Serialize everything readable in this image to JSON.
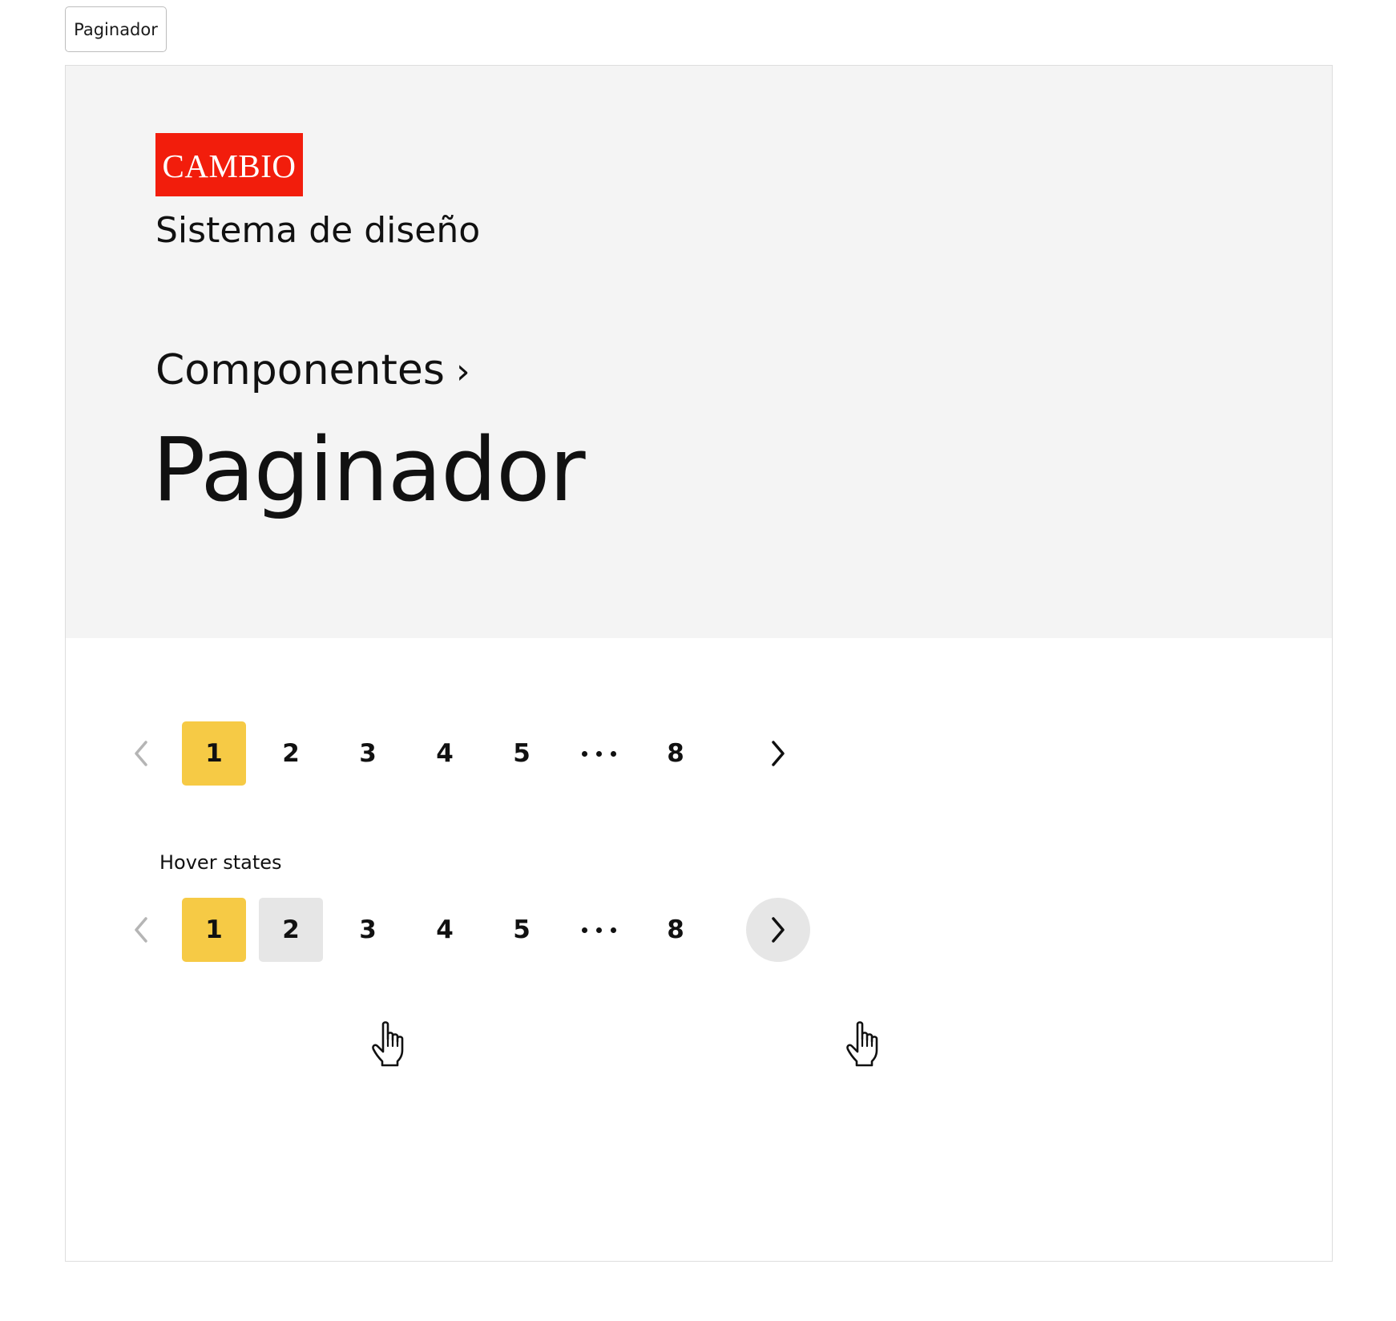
{
  "tag": {
    "label": "Paginador"
  },
  "header": {
    "logo_text": "CAMBIO",
    "subtitle": "Sistema de diseño",
    "breadcrumb": {
      "link": "Componentes",
      "separator": "›"
    },
    "title": "Paginador"
  },
  "colors": {
    "logo_red": "#f21d0c",
    "header_bg": "#f4f4f4",
    "active_page": "#f6ca45",
    "hover_bg": "#e6e6e6",
    "disabled_arrow": "#b5b5b5"
  },
  "paginator_default": {
    "prev_icon": "chevron-left-icon",
    "pages": [
      "1",
      "2",
      "3",
      "4",
      "5"
    ],
    "ellipsis": "•••",
    "last_page": "8",
    "next_icon": "chevron-right-icon",
    "active_page": "1"
  },
  "hover_section": {
    "label": "Hover states"
  },
  "paginator_hover": {
    "prev_icon": "chevron-left-icon",
    "pages": [
      "1",
      "2",
      "3",
      "4",
      "5"
    ],
    "ellipsis": "•••",
    "last_page": "8",
    "next_icon": "chevron-right-icon",
    "active_page": "1",
    "hovered_page": "2",
    "hovered_next": true,
    "cursor_icon": "hand-pointer-icon"
  }
}
